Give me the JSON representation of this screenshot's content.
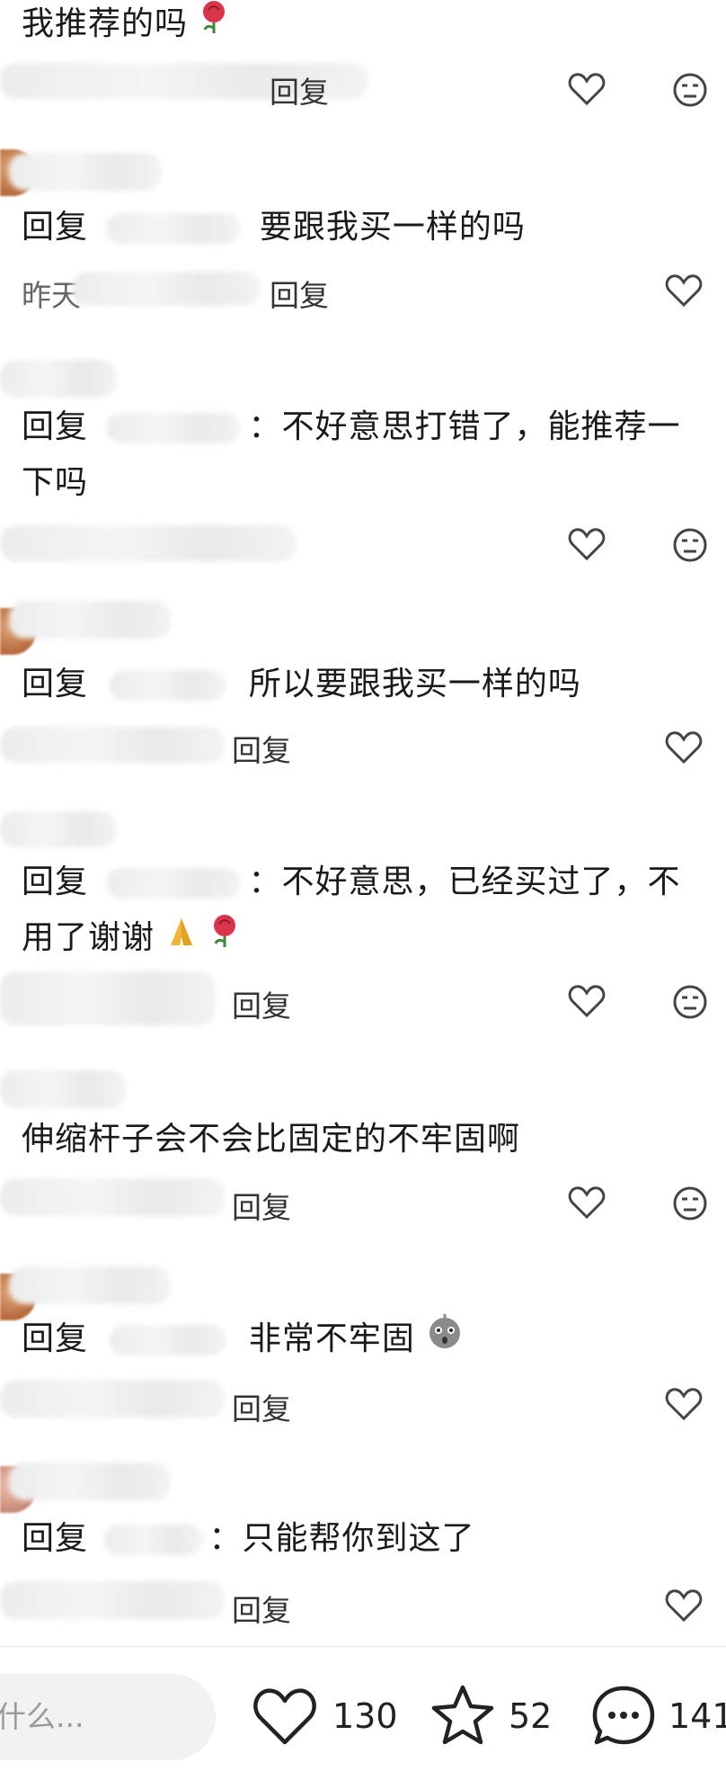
{
  "comments": [
    {
      "text": "我推荐的吗",
      "emoji": "rose"
    },
    {
      "reply_prefix": "回复",
      "text": "要跟我买一样的吗",
      "meta_time": "昨天",
      "meta_reply": "回复"
    },
    {
      "reply_prefix": "回复",
      "text_line1": "：不好意思打错了，能推荐一",
      "text_line2": "下吗"
    },
    {
      "reply_prefix": "回复",
      "text": "所以要跟我买一样的吗",
      "meta_reply": "回复"
    },
    {
      "reply_prefix": "回复",
      "text_line1": "：不好意思，已经买过了，不",
      "text_line2": "用了谢谢",
      "meta_reply": "回复"
    },
    {
      "text": "伸缩杆子会不会比固定的不牢固啊",
      "meta_reply": "回复"
    },
    {
      "reply_prefix": "回复",
      "text": "非常不牢固",
      "emoji": "shocked-face",
      "meta_reply": "回复"
    },
    {
      "reply_prefix": "回复",
      "text": "：只能帮你到这了",
      "meta_reply": "回复"
    }
  ],
  "top_meta_reply": "回复",
  "bottom_bar": {
    "input_placeholder": "什么...",
    "like_count": "130",
    "star_count": "52",
    "comment_count": "141"
  },
  "colors": {
    "icon_stroke": "#444444",
    "rose": "#d9344a"
  }
}
